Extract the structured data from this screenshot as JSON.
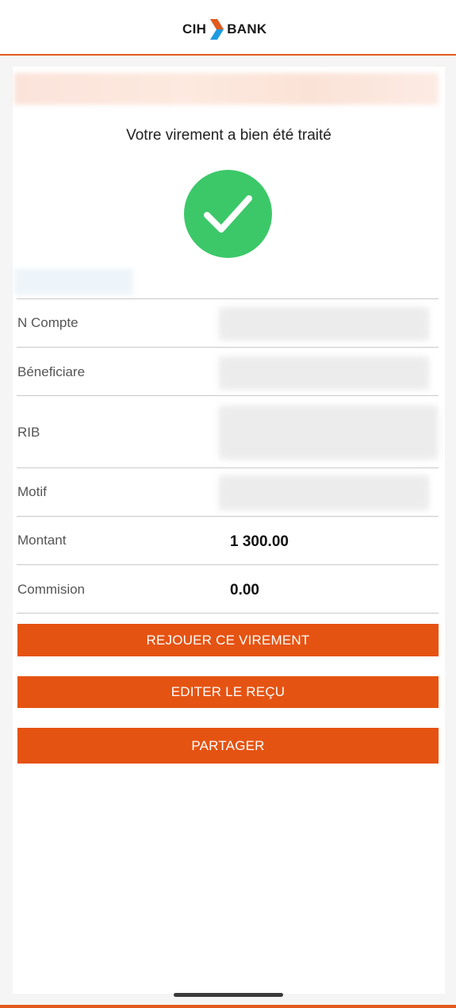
{
  "header": {
    "logo_left": "CIH",
    "logo_right": "BANK",
    "colors": {
      "accent": "#e35a1c",
      "logo_blue": "#1d9be0"
    }
  },
  "main": {
    "success_message": "Votre virement a bien été traité",
    "success_icon": "check-circle-icon",
    "success_color": "#3cc869",
    "details": [
      {
        "label": "N Compte",
        "value": ""
      },
      {
        "label": "Béneficiare",
        "value": ""
      },
      {
        "label": "RIB",
        "value": ""
      },
      {
        "label": "Motif",
        "value": ""
      },
      {
        "label": "Montant",
        "value": "1 300.00"
      },
      {
        "label": "Commision",
        "value": "0.00"
      }
    ],
    "buttons": {
      "replay": "REJOUER CE VIREMENT",
      "edit_receipt": "EDITER LE REÇU",
      "share": "PARTAGER"
    },
    "button_color": "#e55312"
  }
}
